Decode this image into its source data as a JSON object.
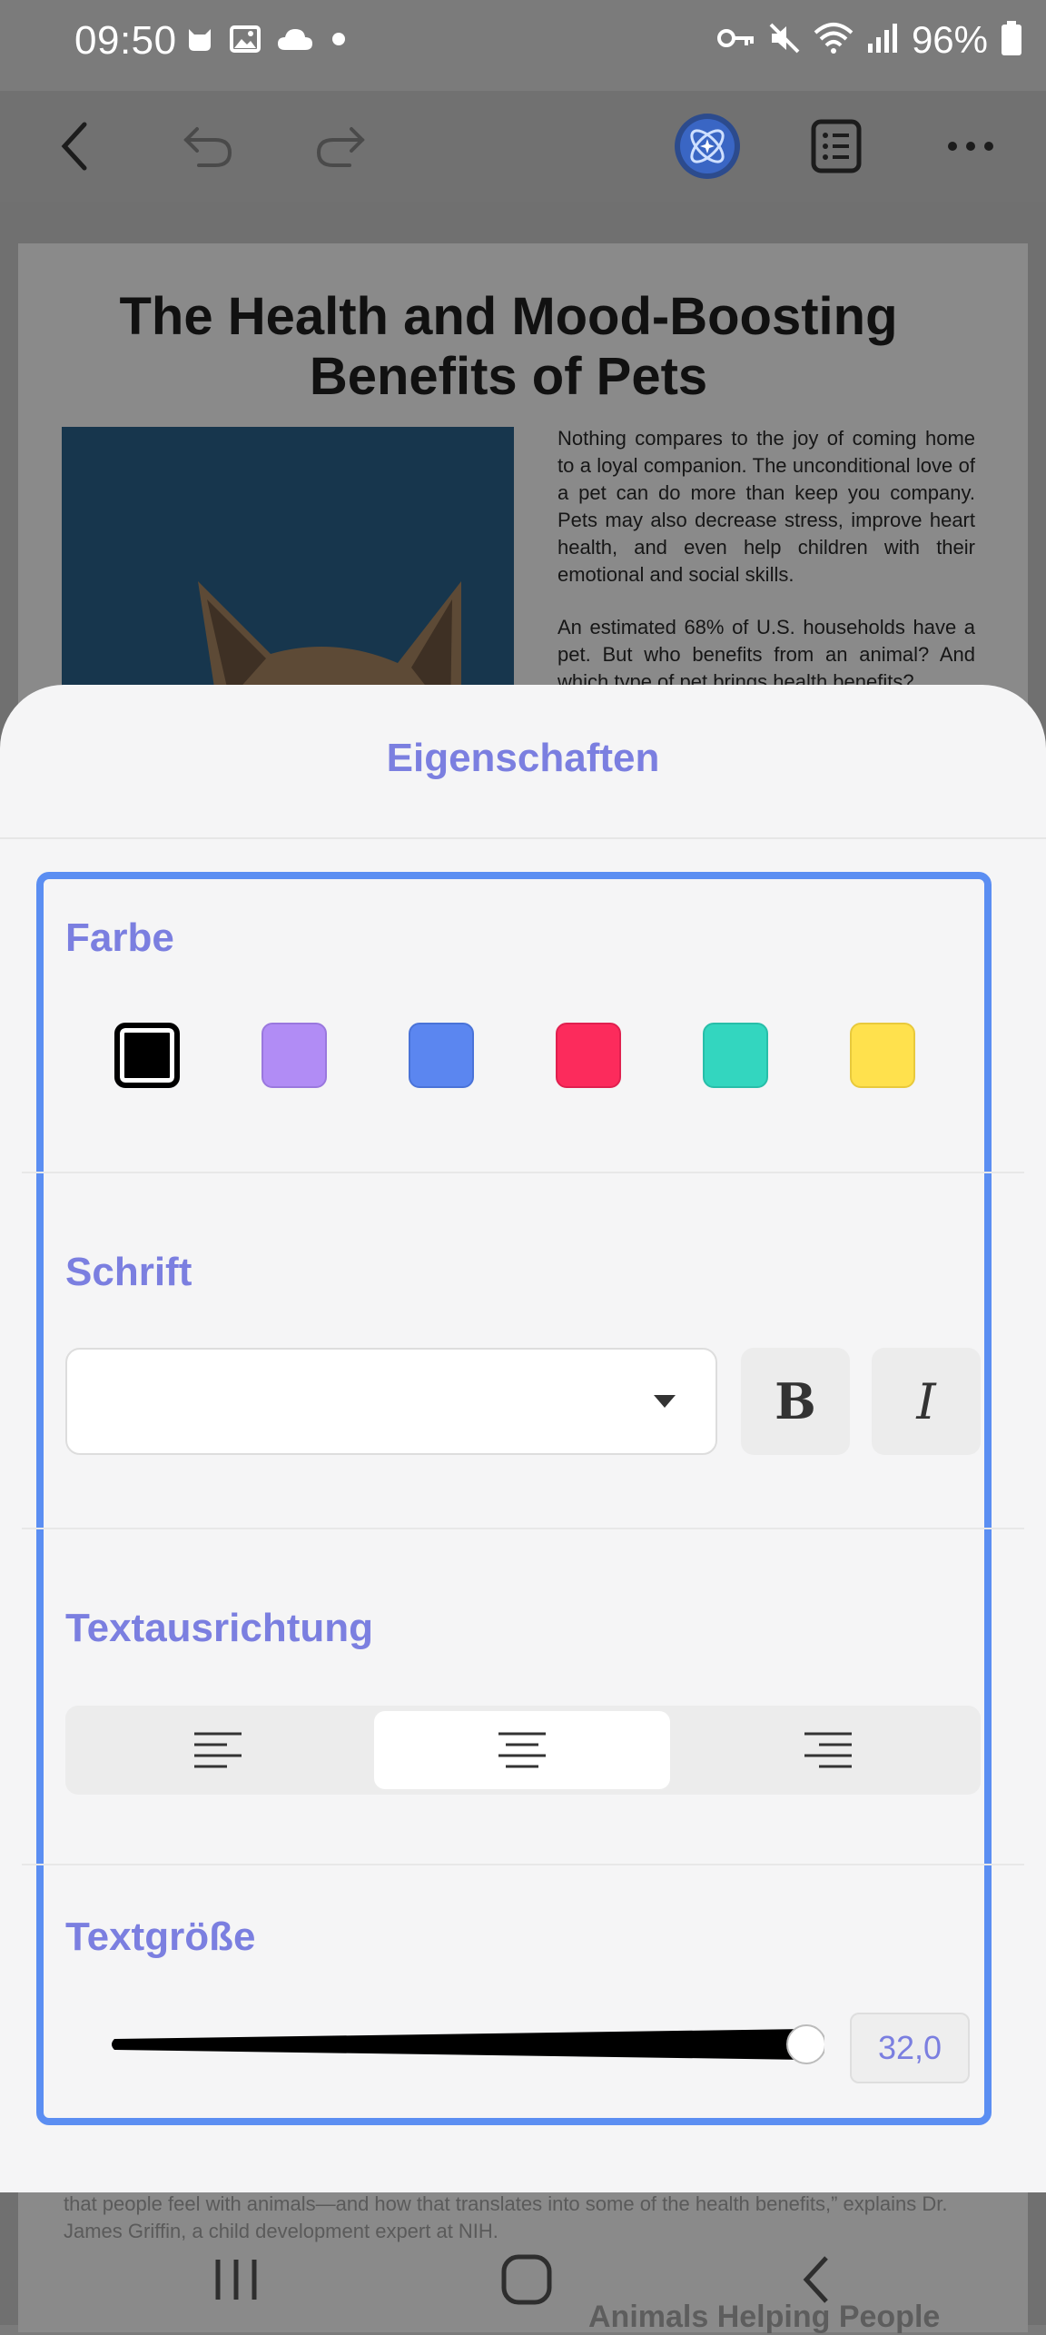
{
  "status_bar": {
    "time": "09:50",
    "battery_percent": "96%",
    "left_icons": [
      "cat-icon",
      "image-icon",
      "cloud-icon",
      "dot-icon"
    ],
    "right_icons": [
      "key-icon",
      "mute-icon",
      "wifi-icon",
      "signal-icon",
      "battery-icon"
    ]
  },
  "toolbar": {
    "icons": [
      "back-arrow-icon",
      "undo-icon",
      "redo-icon",
      "ai-assistant-icon",
      "list-icon",
      "more-icon"
    ]
  },
  "document": {
    "title": "The Health and Mood-Boosting Benefits of Pets",
    "paragraph_1": "Nothing compares to the joy of coming home to a loyal companion. The unconditional love of a pet can do more than keep you company. Pets may also decrease stress, improve heart health, and even help children with their emotional and social skills.",
    "paragraph_2": "An estimated 68% of U.S. households have a pet. But who benefits from an animal? And which type of pet brings health benefits?",
    "bottom_paragraph": "that people feel with animals—and how that translates into some of the health benefits,” explains Dr. James Griffin, a child development expert at NIH.",
    "bottom_heading": "Animals Helping People"
  },
  "sheet": {
    "title": "Eigenschaften",
    "color": {
      "label": "Farbe",
      "swatches": [
        "#000000",
        "#b18cf5",
        "#5b86f0",
        "#fc2b5c",
        "#33d6bf",
        "#ffe14d"
      ],
      "selected_index": 0
    },
    "font": {
      "label": "Schrift",
      "selected_value": "",
      "bold_label": "B",
      "italic_label": "I"
    },
    "alignment": {
      "label": "Textausrichtung",
      "options": [
        "left",
        "center",
        "right"
      ],
      "selected": "center"
    },
    "size": {
      "label": "Textgröße",
      "value": "32,0",
      "slider_fraction": 1.0
    }
  },
  "colors": {
    "accent": "#7b7fe0",
    "panel_border": "#5b8ef2"
  },
  "nav_bar": {
    "icons": [
      "recent-apps-icon",
      "home-icon",
      "back-icon"
    ]
  }
}
